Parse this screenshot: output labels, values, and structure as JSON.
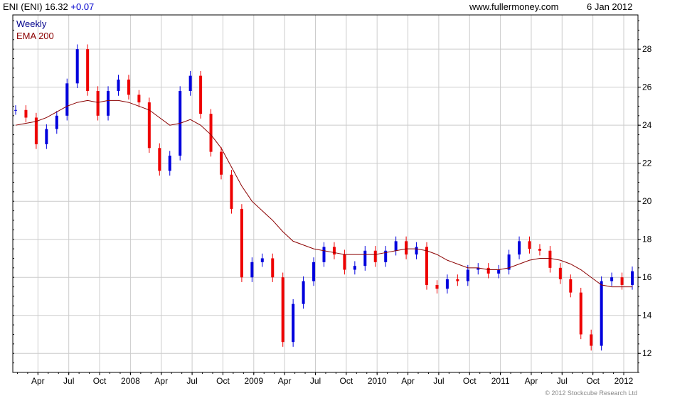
{
  "header": {
    "title": "ENI (ENI) 16.32",
    "change": "+0.07",
    "site": "www.fullermoney.com",
    "date": "6 Jan 2012"
  },
  "legend": {
    "weekly": "Weekly",
    "ema": "EMA 200"
  },
  "footer": {
    "copyright": "© 2012 Stockcube Research Ltd"
  },
  "colors": {
    "up": "#0000dd",
    "down": "#ee0000",
    "ema": "#8b0000",
    "grid": "#cccccc",
    "frame": "#000000",
    "legend_weekly": "#00008b",
    "legend_ema": "#8b0000"
  },
  "chart_data": {
    "type": "line",
    "title": "ENI (ENI) 16.32 +0.07",
    "xlabel": "",
    "ylabel": "",
    "ylim": [
      11.0,
      29.8
    ],
    "y_ticks": [
      12,
      14,
      16,
      18,
      20,
      22,
      24,
      26,
      28
    ],
    "x_ticks": [
      "Apr",
      "Jul",
      "Oct",
      "2008",
      "Apr",
      "Jul",
      "Oct",
      "2009",
      "Apr",
      "Jul",
      "Oct",
      "2010",
      "Apr",
      "Jul",
      "Oct",
      "2011",
      "Apr",
      "Jul",
      "Oct",
      "2012"
    ],
    "x": [
      "2007-01",
      "2007-02",
      "2007-03",
      "2007-04",
      "2007-05",
      "2007-06",
      "2007-07",
      "2007-08",
      "2007-09",
      "2007-10",
      "2007-11",
      "2007-12",
      "2008-01",
      "2008-02",
      "2008-03",
      "2008-04",
      "2008-05",
      "2008-06",
      "2008-07",
      "2008-08",
      "2008-09",
      "2008-10",
      "2008-11",
      "2008-12",
      "2009-01",
      "2009-02",
      "2009-03",
      "2009-04",
      "2009-05",
      "2009-06",
      "2009-07",
      "2009-08",
      "2009-09",
      "2009-10",
      "2009-11",
      "2009-12",
      "2010-01",
      "2010-02",
      "2010-03",
      "2010-04",
      "2010-05",
      "2010-06",
      "2010-07",
      "2010-08",
      "2010-09",
      "2010-10",
      "2010-11",
      "2010-12",
      "2011-01",
      "2011-02",
      "2011-03",
      "2011-04",
      "2011-05",
      "2011-06",
      "2011-07",
      "2011-08",
      "2011-09",
      "2011-10",
      "2011-11",
      "2011-12",
      "2012-01"
    ],
    "grid": true,
    "grid_note": "horizontal and vertical gridlines",
    "legend_position": "top-left",
    "y_axis_side": "right",
    "series": [
      {
        "name": "Weekly",
        "style": "candlestick",
        "values": [
          24.8,
          24.4,
          23.0,
          23.8,
          24.5,
          26.2,
          28.0,
          25.8,
          24.5,
          25.8,
          26.4,
          25.6,
          25.2,
          22.8,
          21.6,
          22.4,
          25.8,
          26.6,
          24.6,
          22.6,
          21.4,
          19.6,
          16.0,
          16.8,
          17.0,
          16.0,
          12.6,
          14.6,
          15.8,
          16.8,
          17.6,
          17.2,
          16.4,
          16.6,
          17.4,
          16.8,
          17.4,
          17.9,
          17.2,
          17.6,
          15.6,
          15.4,
          15.9,
          15.8,
          16.4,
          16.5,
          16.2,
          16.4,
          17.2,
          17.9,
          17.5,
          17.4,
          16.5,
          15.9,
          15.2,
          13.0,
          12.4,
          15.8,
          16.0,
          15.6,
          16.32
        ]
      },
      {
        "name": "EMA 200",
        "style": "line",
        "values": [
          24.0,
          24.1,
          24.2,
          24.4,
          24.7,
          25.0,
          25.2,
          25.3,
          25.2,
          25.3,
          25.3,
          25.2,
          25.0,
          24.8,
          24.4,
          24.0,
          24.1,
          24.3,
          24.0,
          23.5,
          22.8,
          21.8,
          20.8,
          20.0,
          19.5,
          19.0,
          18.4,
          17.9,
          17.7,
          17.5,
          17.4,
          17.3,
          17.2,
          17.2,
          17.2,
          17.2,
          17.3,
          17.4,
          17.5,
          17.5,
          17.4,
          17.2,
          16.9,
          16.7,
          16.5,
          16.5,
          16.4,
          16.4,
          16.5,
          16.7,
          16.9,
          17.0,
          17.0,
          16.9,
          16.7,
          16.4,
          16.0,
          15.6,
          15.5,
          15.5,
          15.5
        ]
      }
    ]
  }
}
